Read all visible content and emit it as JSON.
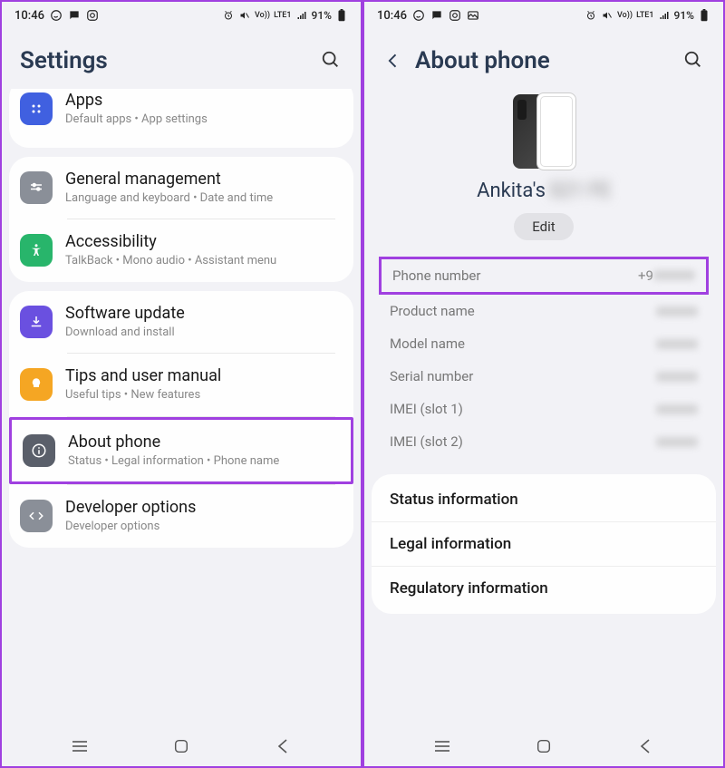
{
  "status": {
    "time": "10:46",
    "battery": "91%",
    "net": "LTE1",
    "carrier": "Vo))"
  },
  "left_screen": {
    "title": "Settings",
    "items": {
      "apps": {
        "title": "Apps",
        "sub": "Default apps  •  App settings"
      },
      "general": {
        "title": "General management",
        "sub": "Language and keyboard  •  Date and time"
      },
      "accessibility": {
        "title": "Accessibility",
        "sub": "TalkBack  •  Mono audio  •  Assistant menu"
      },
      "software": {
        "title": "Software update",
        "sub": "Download and install"
      },
      "tips": {
        "title": "Tips and user manual",
        "sub": "Useful tips  •  New features"
      },
      "about": {
        "title": "About phone",
        "sub": "Status  •  Legal information  •  Phone name"
      },
      "dev": {
        "title": "Developer options",
        "sub": "Developer options"
      }
    }
  },
  "right_screen": {
    "title": "About phone",
    "device_name_prefix": "Ankita's",
    "edit": "Edit",
    "info": {
      "phone_number": {
        "label": "Phone number",
        "value": "+9"
      },
      "product_name": {
        "label": "Product name"
      },
      "model_name": {
        "label": "Model name"
      },
      "serial": {
        "label": "Serial number"
      },
      "imei1": {
        "label": "IMEI (slot 1)"
      },
      "imei2": {
        "label": "IMEI (slot 2)"
      }
    },
    "links": {
      "status": "Status information",
      "legal": "Legal information",
      "regulatory": "Regulatory information"
    }
  }
}
